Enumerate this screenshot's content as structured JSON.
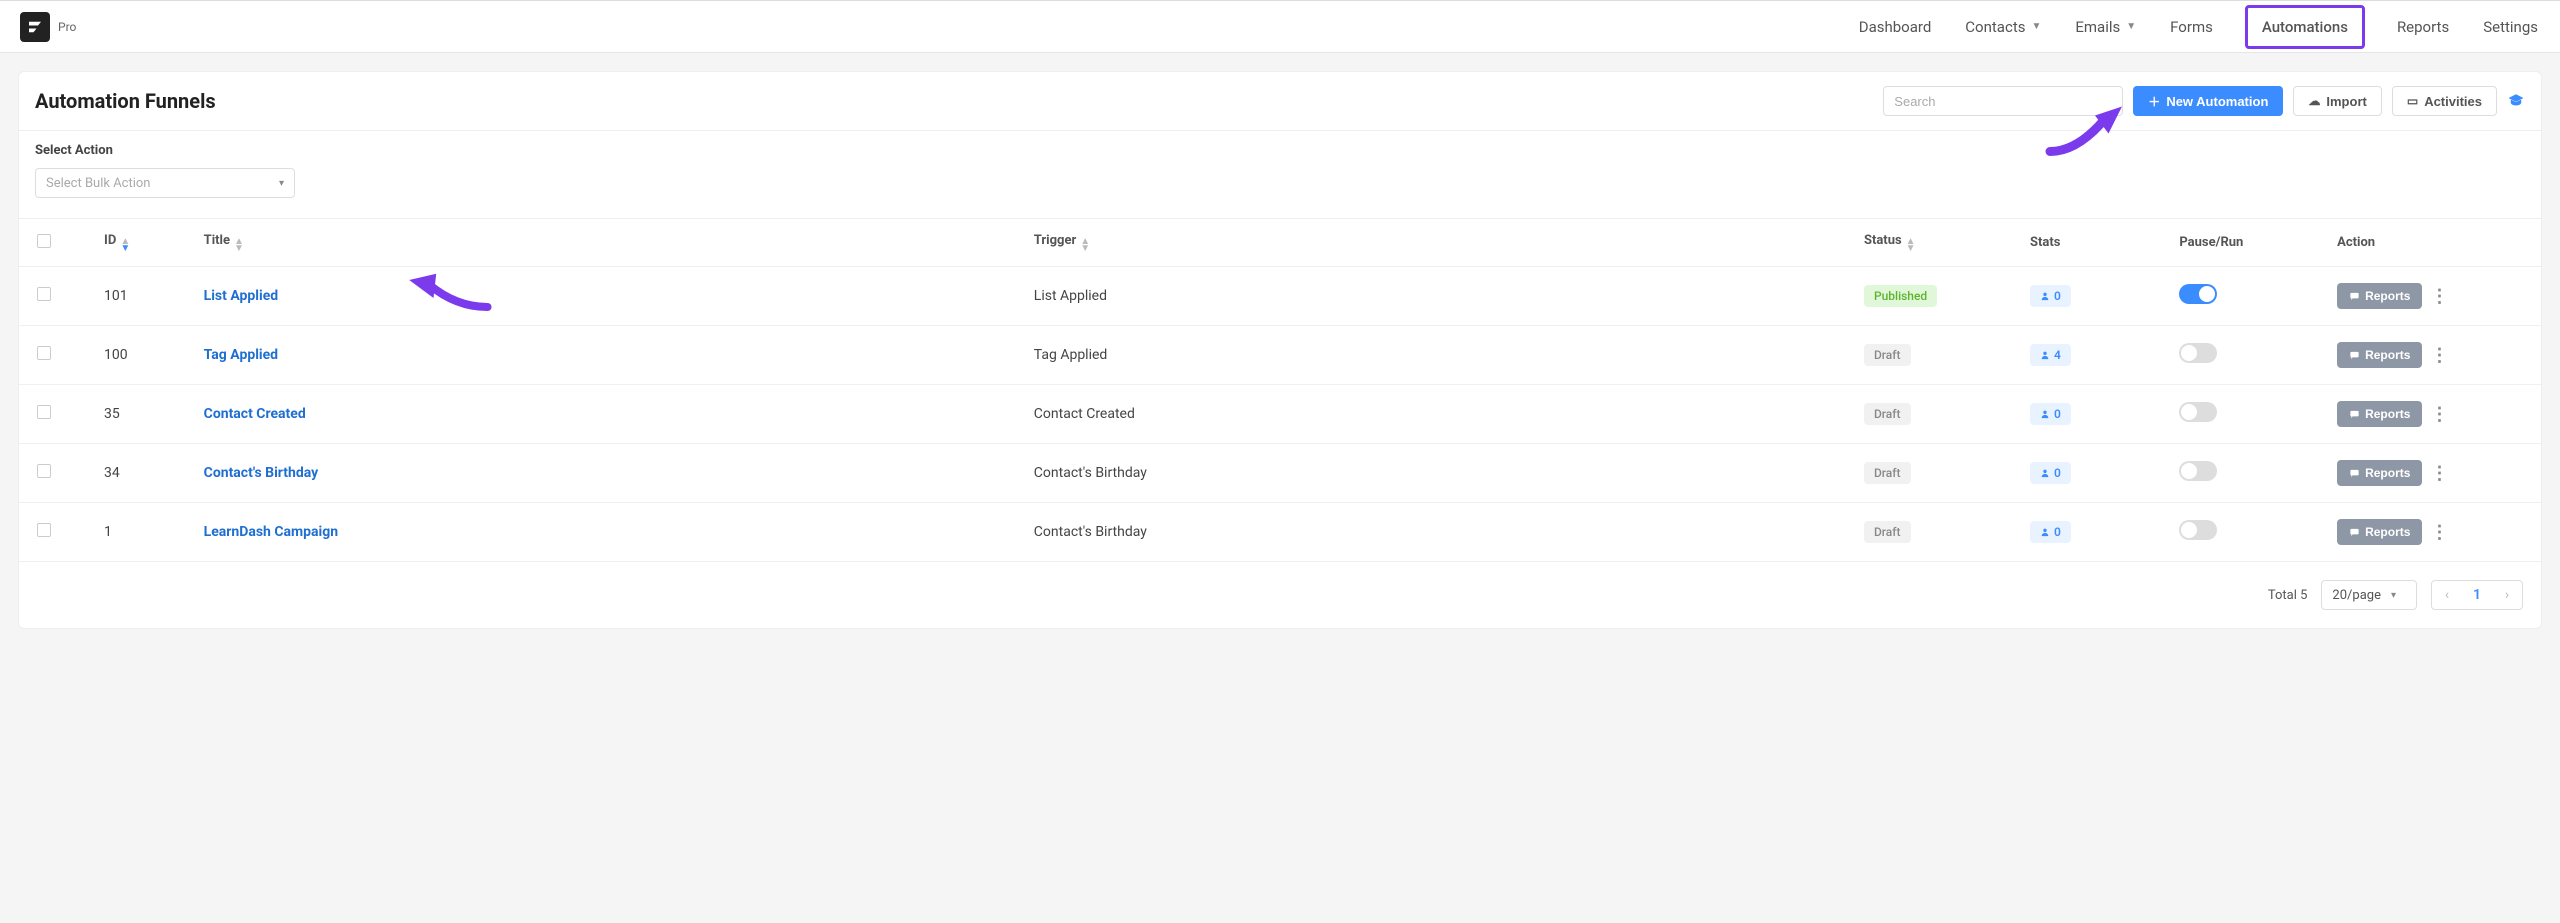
{
  "brand": {
    "label": "Pro"
  },
  "nav": {
    "dashboard": "Dashboard",
    "contacts": "Contacts",
    "emails": "Emails",
    "forms": "Forms",
    "automations": "Automations",
    "reports": "Reports",
    "settings": "Settings"
  },
  "page_title": "Automation Funnels",
  "search_placeholder": "Search",
  "buttons": {
    "new_automation": "New Automation",
    "import": "Import",
    "activities": "Activities"
  },
  "bulk": {
    "label": "Select Action",
    "placeholder": "Select Bulk Action"
  },
  "columns": {
    "id": "ID",
    "title": "Title",
    "trigger": "Trigger",
    "status": "Status",
    "stats": "Stats",
    "pause": "Pause/Run",
    "action": "Action"
  },
  "status_labels": {
    "published": "Published",
    "draft": "Draft"
  },
  "row_action_label": "Reports",
  "rows": [
    {
      "id": "101",
      "title": "List Applied",
      "trigger": "List Applied",
      "status": "published",
      "stats": "0",
      "on": true
    },
    {
      "id": "100",
      "title": "Tag Applied",
      "trigger": "Tag Applied",
      "status": "draft",
      "stats": "4",
      "on": false
    },
    {
      "id": "35",
      "title": "Contact Created",
      "trigger": "Contact Created",
      "status": "draft",
      "stats": "0",
      "on": false
    },
    {
      "id": "34",
      "title": "Contact's Birthday",
      "trigger": "Contact's Birthday",
      "status": "draft",
      "stats": "0",
      "on": false
    },
    {
      "id": "1",
      "title": "LearnDash Campaign",
      "trigger": "Contact's Birthday",
      "status": "draft",
      "stats": "0",
      "on": false
    }
  ],
  "pagination": {
    "total_label": "Total 5",
    "per_page": "20/page",
    "current": "1"
  }
}
